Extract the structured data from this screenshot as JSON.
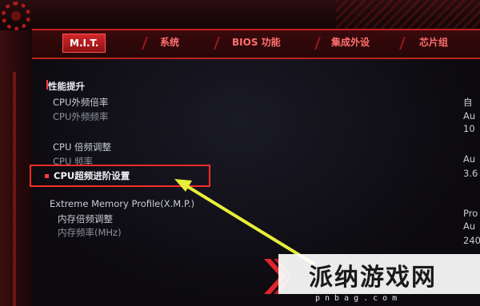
{
  "tabs": [
    {
      "label": "M.I.T.",
      "active": true
    },
    {
      "label": "系统",
      "active": false
    },
    {
      "label": "BIOS 功能",
      "active": false
    },
    {
      "label": "集成外设",
      "active": false
    },
    {
      "label": "芯片组",
      "active": false
    }
  ],
  "sections": {
    "performance_header": "性能提升",
    "rows": [
      {
        "label": "CPU外频倍率",
        "value": "自"
      },
      {
        "label": "CPU外频频率",
        "value": "Au"
      },
      {
        "label": "",
        "value": "10"
      },
      {
        "label": "CPU 倍频调整",
        "value": ""
      },
      {
        "label": "CPU 频率",
        "value": "Au"
      },
      {
        "label": "CPU超频进阶设置",
        "value": "3.6"
      },
      {
        "label": "Extreme Memory Profile(X.M.P.)",
        "value": "Pro"
      },
      {
        "label": "内存倍频调整",
        "value": "Au"
      },
      {
        "label": "内存频率(MHz)",
        "value": "240"
      }
    ]
  },
  "highlight_color": "#ff2b2b",
  "arrow_color": "#e8ee3a",
  "watermark": {
    "title": "派纳游戏网",
    "subtitle": "pnbag.com"
  }
}
